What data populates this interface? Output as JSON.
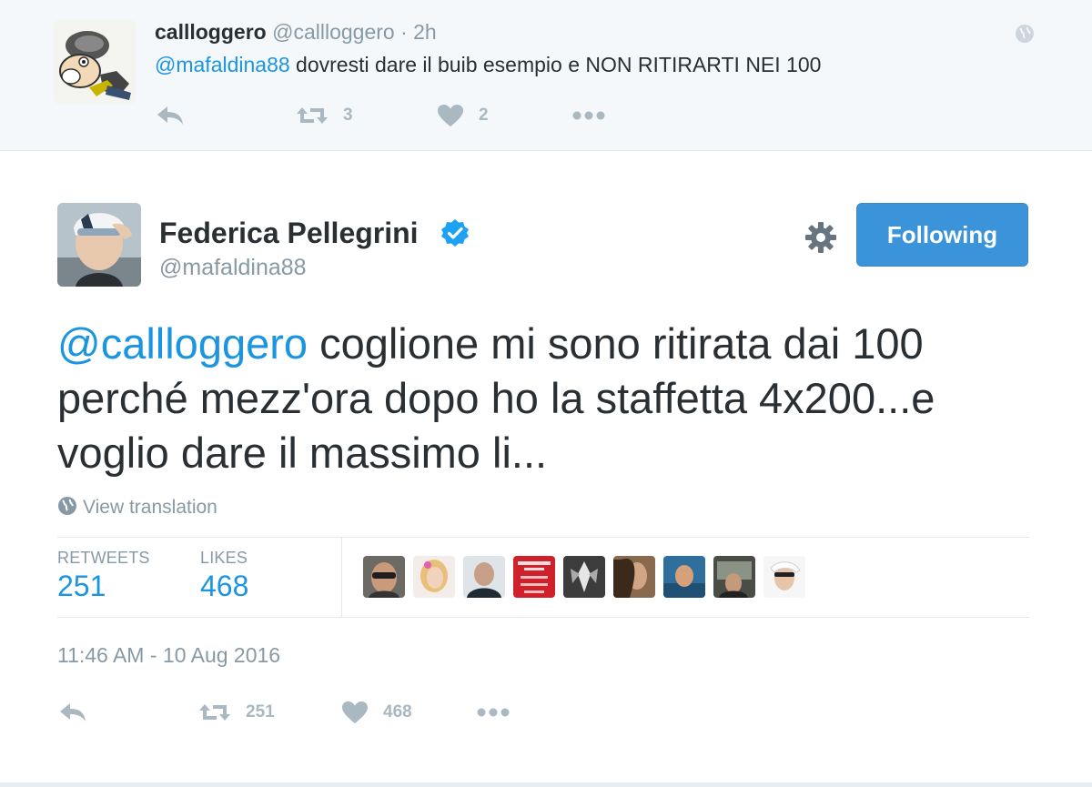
{
  "parent_tweet": {
    "fullname": "callloggero",
    "screen_name": "@callloggero",
    "separator": "·",
    "time_ago": "2h",
    "mention": "@mafaldina88",
    "text": " dovresti dare il buib esempio e NON RITIRARTI NEI 100",
    "retweet_count": "3",
    "like_count": "2",
    "icons": [
      "reply-icon",
      "retweet-icon",
      "heart-icon",
      "more-icon",
      "globe-icon"
    ]
  },
  "tweet": {
    "fullname": "Federica Pellegrini",
    "screen_name": "@mafaldina88",
    "follow_label": "Following",
    "mention": "@callloggero",
    "text": " coglione mi sono ritirata dai 100 perché mezz'ora dopo ho la staffetta 4x200...e voglio dare il massimo li...",
    "translate_label": "View translation",
    "retweets_label": "RETWEETS",
    "retweets": "251",
    "likes_label": "LIKES",
    "likes": "468",
    "liker_count": 9,
    "timestamp": "11:46 AM - 10 Aug 2016",
    "action_retweet_count": "251",
    "action_like_count": "468"
  },
  "colors": {
    "link": "#1b95e0",
    "follow_button": "#3b94d9",
    "verified_badge": "#1da1f2",
    "muted_text": "#8899a6",
    "action_icon": "#aab8c2",
    "liker_avatar_red": "#d0202a"
  }
}
